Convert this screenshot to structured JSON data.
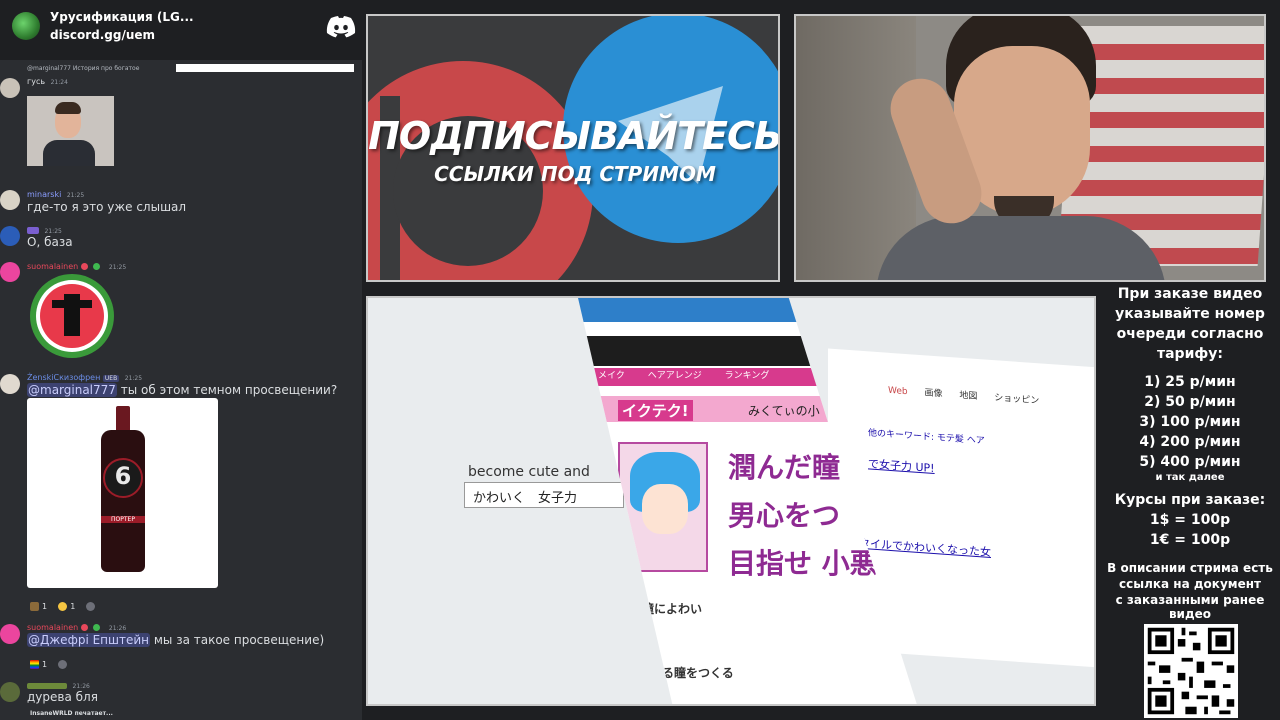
{
  "server": {
    "name": "Урусификация (LG...",
    "link": "discord.gg/uem"
  },
  "messages": [
    {
      "reply": "@marginal777 История про богатое",
      "text": "гусь",
      "time": "21:24"
    },
    {
      "user": "minarski",
      "time": "21:25",
      "text": "где-то я это уже слышал"
    },
    {
      "time": "21:25",
      "text": "О, база"
    },
    {
      "user": "suomalainen",
      "time": "21:25"
    },
    {
      "user": "ŻenskiСкизофрен",
      "badge": "UEB",
      "time": "21:25",
      "mention": "@marginal777",
      "text": "ты об этом темном просвещении?"
    },
    {
      "user": "suomalainen",
      "time": "21:26",
      "mention": "@Джефрі Епштейн",
      "text": "мы за такое просвещение)"
    },
    {
      "time": "21:26",
      "text": "дурева бля"
    }
  ],
  "reactions_a": [
    "1",
    "1"
  ],
  "reactions_b": [
    "1"
  ],
  "typing": "InsaneWRLD печатает...",
  "beer_label": "ПОРТЕР",
  "beer_number": "6",
  "promo": {
    "title": "ПОДПИСЫВАЙТЕСЬ",
    "subtitle": "ССЫЛКИ ПОД СТРИМОМ"
  },
  "screen": {
    "left_text": "become cute and",
    "left_input": "かわいく　女子力",
    "nav": [
      "メイク",
      "ヘアアレンジ",
      "ランキング"
    ],
    "banner": "イクテク!",
    "banner_right": "みくてぃの小",
    "headline": [
      "潤んだ瞳",
      "男心をつ",
      "目指せ 小悪"
    ],
    "section1": "んだ瞳によわい",
    "section2": "うるる瞳をつくる",
    "google_tabs": [
      "Web",
      "画像",
      "地図",
      "ショッピン"
    ],
    "google_link": "で女子力 UP!",
    "google_kw": "他のキーワード:  モテ髪  ヘア",
    "google_link2": "スタイルでかわいくなった女"
  },
  "info": {
    "order_lines": [
      "При заказе видео",
      "указывайте номер",
      "очереди согласно",
      "тарифу:"
    ],
    "tariffs": [
      "1) 25 р/мин",
      "2) 50 р/мин",
      "3) 100 р/мин",
      "4) 200 р/мин",
      "5) 400 р/мин"
    ],
    "etc": "и так далее",
    "rates_title": "Курсы при заказе:",
    "rates": [
      "1$ = 100р",
      "1€ = 100р"
    ],
    "desc": [
      "В описании стрима есть",
      "ссылка на документ",
      "с заказанными ранее",
      "видео"
    ]
  },
  "colors": {
    "accent_red": "#c8484a",
    "telegram_blue": "#2a8fd4",
    "mention_bg": "#3c4270",
    "chat_bg": "#2b2d31"
  }
}
